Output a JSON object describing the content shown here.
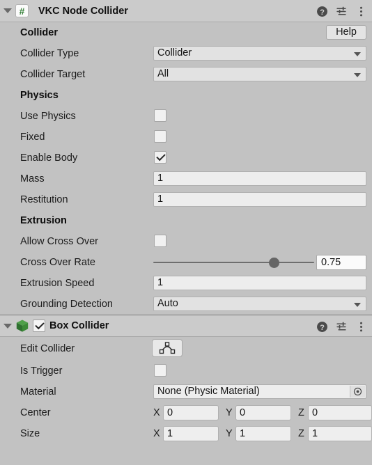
{
  "components": [
    {
      "header": {
        "title": "VKC Node Collider",
        "icon": "csharp-script-icon",
        "icon_glyph": "#",
        "icon_color": "#2f7d32",
        "foldout_expanded": true,
        "has_enable_checkbox": false,
        "icons": [
          "help-icon",
          "preset-icon",
          "more-menu-icon"
        ]
      },
      "help_button": "Help",
      "rows": [
        {
          "type": "section",
          "label": "Collider"
        },
        {
          "type": "dropdown",
          "label": "Collider Type",
          "value": "Collider"
        },
        {
          "type": "dropdown",
          "label": "Collider Target",
          "value": "All"
        },
        {
          "type": "section",
          "label": "Physics"
        },
        {
          "type": "checkbox",
          "label": "Use Physics",
          "checked": false
        },
        {
          "type": "checkbox",
          "label": "Fixed",
          "checked": false
        },
        {
          "type": "checkbox",
          "label": "Enable Body",
          "checked": true
        },
        {
          "type": "text",
          "label": "Mass",
          "value": "1"
        },
        {
          "type": "text",
          "label": "Restitution",
          "value": "1"
        },
        {
          "type": "section",
          "label": "Extrusion"
        },
        {
          "type": "checkbox",
          "label": "Allow Cross Over",
          "checked": false
        },
        {
          "type": "slider",
          "label": "Cross Over Rate",
          "value": "0.75",
          "fill_percent": 75
        },
        {
          "type": "text",
          "label": "Extrusion Speed",
          "value": "1"
        },
        {
          "type": "dropdown",
          "label": "Grounding Detection",
          "value": "Auto"
        }
      ]
    },
    {
      "header": {
        "title": "Box Collider",
        "icon": "box-collider-cube-icon",
        "icon_color": "#3f8f3a",
        "foldout_expanded": true,
        "has_enable_checkbox": true,
        "enabled": true,
        "icons": [
          "help-icon",
          "preset-icon",
          "more-menu-icon"
        ]
      },
      "rows": [
        {
          "type": "button",
          "label": "Edit Collider",
          "button_icon": "edit-collider-icon"
        },
        {
          "type": "checkbox",
          "label": "Is Trigger",
          "checked": false
        },
        {
          "type": "object",
          "label": "Material",
          "value": "None (Physic Material)",
          "picker_icon": "object-picker-icon"
        },
        {
          "type": "vector3",
          "label": "Center",
          "axes": [
            "X",
            "Y",
            "Z"
          ],
          "values": [
            "0",
            "0",
            "0"
          ]
        },
        {
          "type": "vector3",
          "label": "Size",
          "axes": [
            "X",
            "Y",
            "Z"
          ],
          "values": [
            "1",
            "1",
            "1"
          ]
        }
      ]
    }
  ],
  "theme": {
    "background": "#c2c2c2",
    "header_background": "#cbcbcb",
    "field_background": "#ededed",
    "text": "#1b1b1b",
    "accent_green": "#2f7d32"
  }
}
